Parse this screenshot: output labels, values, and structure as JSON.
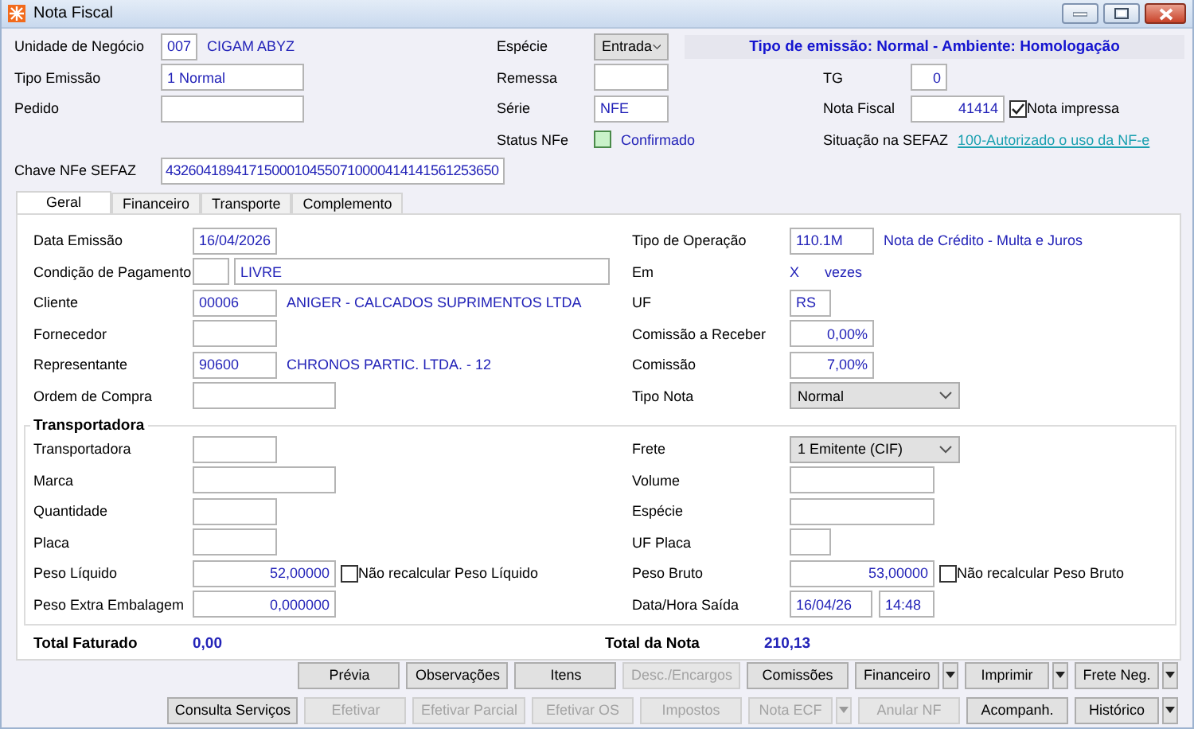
{
  "window": {
    "title": "Nota Fiscal"
  },
  "header": {
    "unidade": {
      "label": "Unidade de Negócio",
      "value": "007",
      "name": "CIGAM ABYZ"
    },
    "especie": {
      "label": "Espécie",
      "value": "Entrada"
    },
    "banner": "Tipo de emissão: Normal - Ambiente: Homologação",
    "tipo_emissao": {
      "label": "Tipo Emissão",
      "value": "1 Normal"
    },
    "remessa": {
      "label": "Remessa"
    },
    "tg": {
      "label": "TG",
      "value": "0"
    },
    "pedido": {
      "label": "Pedido"
    },
    "serie": {
      "label": "Série",
      "value": "NFE"
    },
    "nota_fiscal": {
      "label": "Nota Fiscal",
      "value": "41414",
      "printed": {
        "label": "Nota impressa",
        "checked": true
      }
    },
    "status_nfe": {
      "label": "Status NFe",
      "value": "Confirmado"
    },
    "situacao": {
      "label": "Situação na SEFAZ",
      "link": "100-Autorizado o uso da NF-e"
    },
    "chave": {
      "label": "Chave NFe SEFAZ",
      "value": "43260418941715000104550710000414141561253650"
    }
  },
  "tabs": [
    {
      "label": "Geral",
      "selected": true
    },
    {
      "label": "Financeiro",
      "selected": false
    },
    {
      "label": "Transporte",
      "selected": false
    },
    {
      "label": "Complemento",
      "selected": false
    }
  ],
  "general": {
    "rows": [
      {
        "left": {
          "label": "Data Emissão",
          "kind": "field",
          "value": "16/04/2026"
        },
        "right": {
          "label": "Tipo de Operação",
          "kind": "code_name",
          "value": "110.1M",
          "name": "Nota de Crédito - Multa e Juros"
        }
      },
      {
        "left": {
          "label": "Condição de Pagamento",
          "kind": "code_field",
          "name": "LIVRE"
        },
        "right": {
          "label": "Em",
          "kind": "multiplier",
          "value": "X",
          "unit": "vezes"
        }
      },
      {
        "left": {
          "label": "Cliente",
          "kind": "code_name",
          "value": "00006",
          "name": "ANIGER - CALCADOS SUPRIMENTOS LTDA"
        },
        "right": {
          "label": "UF",
          "kind": "field",
          "value": "RS"
        }
      },
      {
        "left": {
          "label": "Fornecedor",
          "kind": "field"
        },
        "right": {
          "label": "Comissão a Receber",
          "kind": "number",
          "value": "0,00%"
        }
      },
      {
        "left": {
          "label": "Representante",
          "kind": "code_name",
          "value": "90600",
          "name": "CHRONOS PARTIC. LTDA. - 12"
        },
        "right": {
          "label": "Comissão",
          "kind": "number",
          "value": "7,00%"
        }
      },
      {
        "left": {
          "label": "Ordem de Compra",
          "kind": "field"
        },
        "right": {
          "label": "Tipo Nota",
          "kind": "select",
          "value": "Normal"
        }
      }
    ]
  },
  "transport": {
    "title": "Transportadora",
    "rows": [
      {
        "left": {
          "label": "Transportadora",
          "kind": "field"
        },
        "right": {
          "label": "Frete",
          "kind": "select",
          "value": "1 Emitente (CIF)"
        }
      },
      {
        "left": {
          "label": "Marca",
          "kind": "field"
        },
        "right": {
          "label": "Volume",
          "kind": "field"
        }
      },
      {
        "left": {
          "label": "Quantidade",
          "kind": "field"
        },
        "right": {
          "label": "Espécie",
          "kind": "field"
        }
      },
      {
        "left": {
          "label": "Placa",
          "kind": "field"
        },
        "right": {
          "label": "UF Placa",
          "kind": "field"
        }
      },
      {
        "left": {
          "label": "Peso Líquido",
          "kind": "number_check",
          "value": "52,00000",
          "check": {
            "label": "Não recalcular Peso Líquido",
            "checked": false
          }
        },
        "right": {
          "label": "Peso Bruto",
          "kind": "number_check",
          "value": "53,00000",
          "check": {
            "label": "Não recalcular Peso Bruto",
            "checked": false
          }
        }
      },
      {
        "left": {
          "label": "Peso Extra Embalagem",
          "kind": "number",
          "value": "0,000000"
        },
        "right": {
          "label": "Data/Hora Saída",
          "kind": "pair",
          "values": [
            "16/04/26",
            "14:48"
          ]
        }
      }
    ]
  },
  "totals": [
    {
      "label": "Total Faturado",
      "value": "0,00"
    },
    {
      "label": "Total da Nota",
      "value": "210,13"
    }
  ],
  "button_rows": [
    [
      {
        "label": "Prévia",
        "disabled": false
      },
      {
        "label": "Observações",
        "disabled": false
      },
      {
        "label": "Itens",
        "disabled": false
      },
      {
        "label": "Desc./Encargos",
        "disabled": true
      },
      {
        "label": "Comissões",
        "disabled": false
      },
      {
        "label": "Financeiro",
        "disabled": false,
        "dropdown": true
      },
      {
        "label": "Imprimir",
        "disabled": false,
        "dropdown": true
      },
      {
        "label": "Frete Neg.",
        "disabled": false,
        "dropdown": true
      }
    ],
    [
      {
        "label": "Consulta Serviços",
        "disabled": false
      },
      {
        "label": "Efetivar",
        "disabled": true
      },
      {
        "label": "Efetivar Parcial",
        "disabled": true
      },
      {
        "label": "Efetivar OS",
        "disabled": true
      },
      {
        "label": "Impostos",
        "disabled": true
      },
      {
        "label": "Nota ECF",
        "disabled": true,
        "dropdown": true
      },
      {
        "label": "Anular NF",
        "disabled": true
      },
      {
        "label": "Acompanh.",
        "disabled": false
      },
      {
        "label": "Histórico",
        "disabled": false,
        "dropdown": true
      }
    ]
  ]
}
